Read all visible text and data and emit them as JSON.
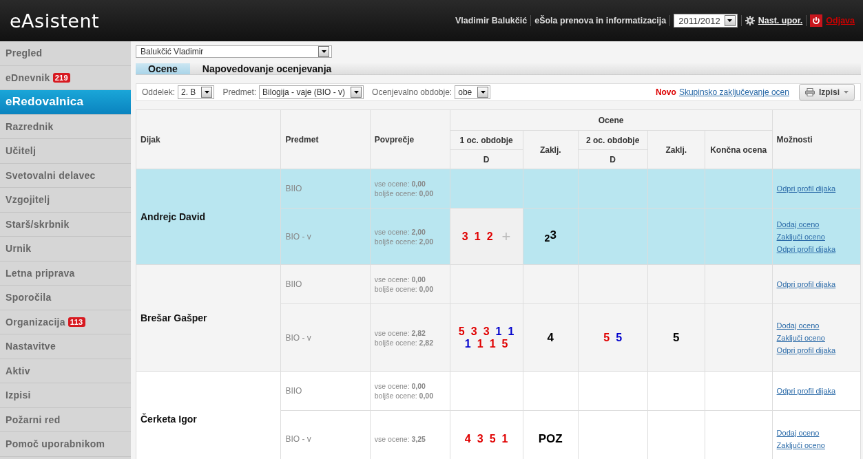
{
  "header": {
    "logo": "eAsistent",
    "user": "Vladimir Balukčić",
    "school": "eŠola prenova in informatizacija",
    "year": "2011/2012",
    "settings": "Nast. upor.",
    "logout": "Odjava"
  },
  "sidebar": {
    "items": [
      {
        "label": "Pregled",
        "selected": false
      },
      {
        "label": "eDnevnik",
        "badge": "219",
        "selected": false
      },
      {
        "label": "eRedovalnica",
        "selected": true
      },
      {
        "label": "Razrednik",
        "selected": false
      },
      {
        "label": "Učitelj",
        "selected": false
      },
      {
        "label": "Svetovalni delavec",
        "selected": false
      },
      {
        "label": "Vzgojitelj",
        "selected": false
      },
      {
        "label": "Starš/skrbnik",
        "selected": false
      },
      {
        "label": "Urnik",
        "selected": false
      },
      {
        "label": "Letna priprava",
        "selected": false
      },
      {
        "label": "Sporočila",
        "selected": false
      },
      {
        "label": "Organizacija",
        "badge": "113",
        "selected": false
      },
      {
        "label": "Nastavitve",
        "selected": false
      },
      {
        "label": "Aktiv",
        "selected": false
      },
      {
        "label": "Izpisi",
        "selected": false
      },
      {
        "label": "Požarni red",
        "selected": false
      },
      {
        "label": "Pomoč uporabnikom",
        "selected": false
      }
    ]
  },
  "teacher_select": {
    "value": "Balukčić Vladimir"
  },
  "tabs": [
    {
      "label": "Ocene",
      "selected": true
    },
    {
      "label": "Napovedovanje ocenjevanja",
      "selected": false
    }
  ],
  "filters": [
    {
      "label": "Oddelek:",
      "value": "2. B"
    },
    {
      "label": "Predmet:",
      "value": "Bilogija - vaje (BIO - v)"
    },
    {
      "label": "Ocenjevalno obdobje:",
      "value": "obe"
    }
  ],
  "new_label": "Novo",
  "group_link": "Skupinsko zaključevanje ocen",
  "print_button": "Izpisi",
  "table": {
    "columns": {
      "student": "Dijak",
      "subject": "Predmet",
      "average": "Povprečje",
      "grades": "Ocene",
      "period_1": "1 oc. obdobje",
      "period_1_sub": "D",
      "final_1": "Zaklj.",
      "period_2": "2 oc. obdobje",
      "period_2_sub": "D",
      "final_2": "Zaklj.",
      "final": "Končna ocena",
      "options": "Možnosti"
    },
    "students": [
      {
        "name": "Andrejc David",
        "selected": true,
        "rows": [
          {
            "subject": "BIIO",
            "avg_all": "vse ocene: **0,00**",
            "avg_better": "boljše ocene: **0,00**",
            "options": [
              "Odpri profil dijaka"
            ]
          },
          {
            "subject": "BIO - v",
            "avg_all": "vse ocene: **2,00**",
            "avg_better": "boljše ocene: **2,00**",
            "p1_highlighted": true,
            "p1_grades": [
              {
                "value": "3",
                "color": "#e00000"
              },
              {
                "value": "1",
                "color": "#e00000"
              },
              {
                "value": "2",
                "color": "#e00000"
              }
            ],
            "p1_add": "+",
            "final_1": "$_{2}$3",
            "options": [
              "Dodaj oceno",
              "Zaključi oceno",
              "Odpri profil dijaka"
            ]
          }
        ]
      },
      {
        "name": "Brešar Gašper",
        "selected": false,
        "rows": [
          {
            "subject": "BIIO",
            "avg_all": "vse ocene: **0,00**",
            "avg_better": "boljše ocene: **0,00**",
            "options": [
              "Odpri profil dijaka"
            ]
          },
          {
            "subject": "BIO - v",
            "avg_all": "vse ocene: **2,82**",
            "avg_better": "boljše ocene: **2,82**",
            "p1_grades": [
              {
                "value": "5",
                "color": "#e00000"
              },
              {
                "value": "3",
                "color": "#e00000"
              },
              {
                "value": "3",
                "color": "#e00000"
              },
              {
                "value": "1",
                "color": "#0000cc"
              },
              {
                "value": "1",
                "color": "#0000cc"
              },
              {
                "value": "1",
                "color": "#0000cc"
              },
              {
                "value": "1",
                "color": "#e00000"
              },
              {
                "value": "1",
                "color": "#e00000"
              },
              {
                "value": "5",
                "color": "#e00000"
              }
            ],
            "final_1": "4",
            "p2_grades": [
              {
                "value": "5",
                "color": "#e00000"
              },
              {
                "value": "5",
                "color": "#0000cc"
              }
            ],
            "final_2": "5",
            "options": [
              "Dodaj oceno",
              "Zaključi oceno",
              "Odpri profil dijaka"
            ]
          }
        ]
      },
      {
        "name": "Čerketa Igor",
        "selected": false,
        "rows": [
          {
            "subject": "BIIO",
            "avg_all": "vse ocene: **0,00**",
            "avg_better": "boljše ocene: **0,00**",
            "options": [
              "Odpri profil dijaka"
            ]
          },
          {
            "subject": "BIO - v",
            "avg_all": "vse ocene: **3,25**",
            "p1_grades": [
              {
                "value": "4",
                "color": "#e00000"
              },
              {
                "value": "3",
                "color": "#e00000"
              },
              {
                "value": "5",
                "color": "#e00000"
              },
              {
                "value": "1",
                "color": "#e00000"
              }
            ],
            "final_1": "POZ",
            "options": [
              "Dodaj oceno",
              "Zaključi oceno"
            ]
          }
        ]
      }
    ]
  }
}
